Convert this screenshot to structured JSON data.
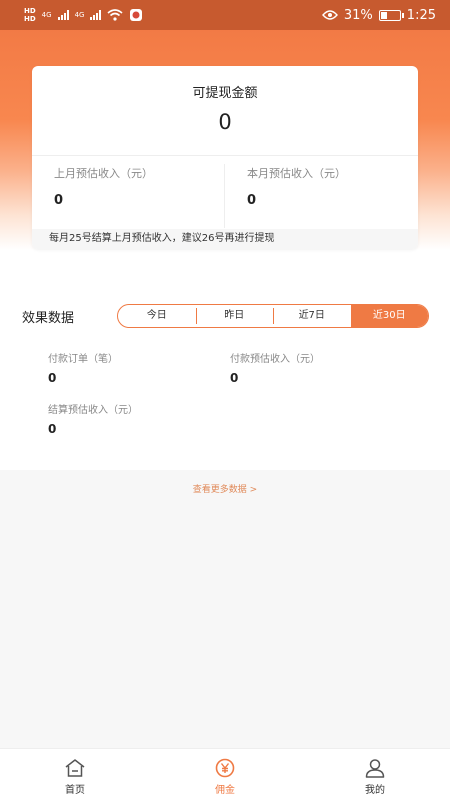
{
  "status_bar": {
    "hd1": "HD",
    "hd2": "HD",
    "net1": "4G",
    "net2": "4G",
    "battery_percent": "31%",
    "time": "1:25",
    "icons": [
      "hd-icon",
      "signal-icon",
      "wifi-icon",
      "app-notification-icon",
      "eye-icon",
      "battery-icon"
    ]
  },
  "balance_card": {
    "title": "可提现金额",
    "amount": "0",
    "last_month_label": "上月预估收入（元）",
    "last_month_value": "0",
    "this_month_label": "本月预估收入（元）",
    "this_month_value": "0",
    "note": "每月25号结算上月预估收入，建议26号再进行提现"
  },
  "performance": {
    "title": "效果数据",
    "tabs": [
      {
        "label": "今日"
      },
      {
        "label": "昨日"
      },
      {
        "label": "近7日"
      },
      {
        "label": "近30日"
      }
    ],
    "active_tab": "近30日",
    "stats": [
      {
        "label": "付款订单（笔）",
        "value": "0"
      },
      {
        "label": "付款预估收入（元）",
        "value": "0"
      },
      {
        "label": "结算预估收入（元）",
        "value": "0"
      }
    ],
    "more_link": "查看更多数据 >"
  },
  "tab_bar": {
    "items": [
      {
        "label": "首页",
        "icon": "home-icon"
      },
      {
        "label": "佣金",
        "icon": "yen-coin-icon"
      },
      {
        "label": "我的",
        "icon": "user-icon"
      }
    ],
    "active": "佣金"
  },
  "colors": {
    "accent": "#ef7a44",
    "header_orange": "#f27a45",
    "status_bar": "#c75a2f"
  }
}
